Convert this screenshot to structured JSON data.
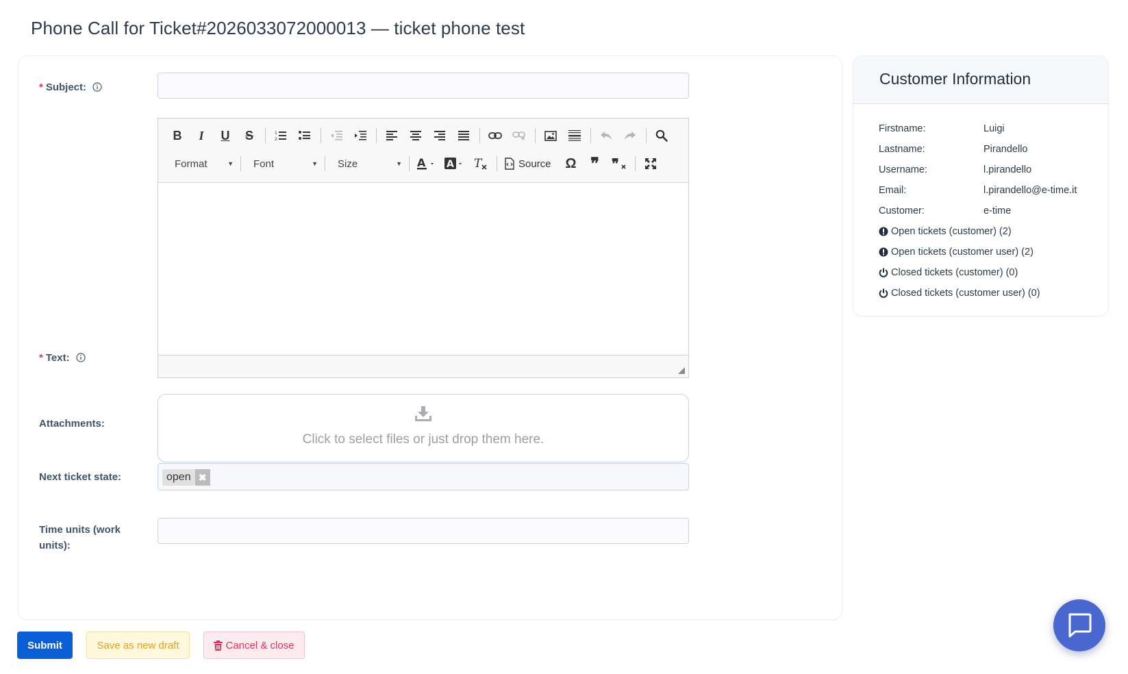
{
  "page": {
    "title": "Phone Call for Ticket#2026033072000013 — ticket phone test"
  },
  "form": {
    "subject_label": "Subject:",
    "subject_value": "",
    "text_label": "Text:",
    "attachments_label": "Attachments:",
    "attachments_hint": "Click to select files or just drop them here.",
    "next_state_label": "Next ticket state:",
    "next_state_value": "open",
    "time_units_label": "Time units (work units):",
    "time_units_value": "",
    "required_marker": "*"
  },
  "editor": {
    "toolbar_row1": [
      "bold-icon",
      "italic-icon",
      "underline-icon",
      "strikethrough-icon",
      "numbered-list-icon",
      "bulleted-list-icon",
      "outdent-icon",
      "indent-icon",
      "align-left-icon",
      "align-center-icon",
      "align-right-icon",
      "justify-icon",
      "link-icon",
      "unlink-icon",
      "image-icon",
      "horizontal-rule-icon",
      "undo-icon",
      "redo-icon",
      "search-icon"
    ],
    "format_label": "Format",
    "font_label": "Font",
    "size_label": "Size",
    "source_label": "Source",
    "content": ""
  },
  "buttons": {
    "submit": "Submit",
    "save_draft": "Save as new draft",
    "cancel_close": "Cancel & close"
  },
  "customer": {
    "title": "Customer Information",
    "fields": [
      {
        "label": "Firstname:",
        "value": "Luigi"
      },
      {
        "label": "Lastname:",
        "value": "Pirandello"
      },
      {
        "label": "Username:",
        "value": "l.pirandello"
      },
      {
        "label": "Email:",
        "value": "l.pirandello@e-time.it"
      },
      {
        "label": "Customer:",
        "value": "e-time"
      }
    ],
    "links": [
      {
        "icon": "exclamation-circle-icon",
        "text": "Open tickets (customer) (2)"
      },
      {
        "icon": "exclamation-circle-icon",
        "text": "Open tickets (customer user) (2)"
      },
      {
        "icon": "power-icon",
        "text": "Closed tickets (customer) (0)"
      },
      {
        "icon": "power-icon",
        "text": "Closed tickets (customer user) (0)"
      }
    ]
  },
  "colors": {
    "primary": "#0b5fd6",
    "draft": "#e0a31f",
    "danger": "#d9345a",
    "chat": "#4a67d0"
  }
}
